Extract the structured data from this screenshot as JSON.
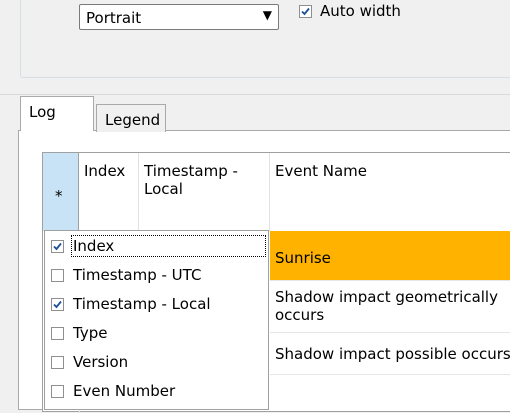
{
  "settings": {
    "orientation": "Portrait",
    "auto_width_label": "Auto width",
    "auto_width_checked": true
  },
  "tabs": [
    {
      "label": "Log",
      "active": true
    },
    {
      "label": "Legend",
      "active": false
    }
  ],
  "grid": {
    "select_all_symbol": "*",
    "columns": {
      "index": "Index",
      "timestamp_local": "Timestamp - Local",
      "event_name": "Event Name"
    },
    "rows": [
      {
        "event_name": "Sunrise",
        "highlighted": true
      },
      {
        "event_name": "Shadow impact geometrically occurs"
      },
      {
        "event_name": "Shadow impact possible occurs"
      }
    ]
  },
  "column_chooser": [
    {
      "label": "Index",
      "checked": true
    },
    {
      "label": "Timestamp - UTC",
      "checked": false
    },
    {
      "label": "Timestamp - Local",
      "checked": true
    },
    {
      "label": "Type",
      "checked": false
    },
    {
      "label": "Version",
      "checked": false
    },
    {
      "label": "Even Number",
      "checked": false
    }
  ],
  "colors": {
    "highlight_row": "#ffb300",
    "select_header": "#c8e3f5",
    "check_mark": "#1e4f9a"
  }
}
